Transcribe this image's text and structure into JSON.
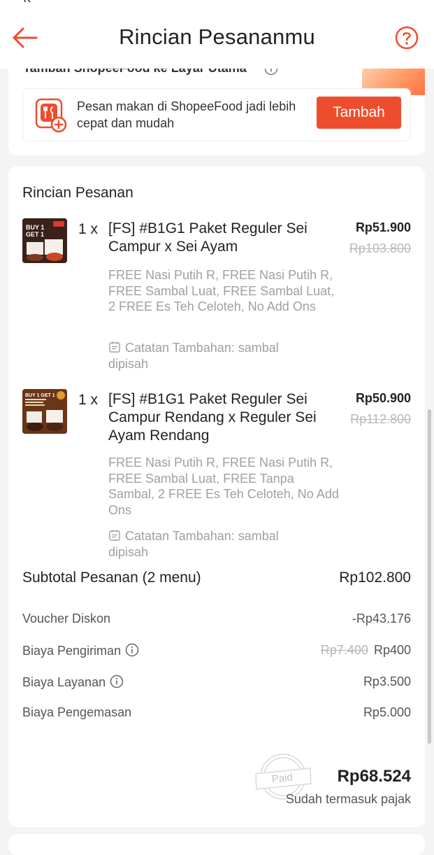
{
  "header": {
    "title": "Rincian Pesananmu",
    "status_fragment": "' K"
  },
  "promo": {
    "top_text": "Tambah ShopeeFood ke Layar Utama",
    "text": "Pesan makan di ShopeeFood jadi lebih cepat dan mudah",
    "button_label": "Tambah"
  },
  "order": {
    "section_title": "Rincian Pesanan",
    "items": [
      {
        "qty": "1 x",
        "name": "[FS] #B1G1 Paket Reguler Sei Campur x Sei Ayam",
        "price": "Rp51.900",
        "old_price": "Rp103.800",
        "addons": "FREE Nasi Putih R, FREE Nasi Putih R, FREE Sambal Luat, FREE Sambal Luat, 2 FREE Es Teh Celoteh, No Add Ons",
        "note": "Catatan Tambahan: sambal dipisah",
        "thumb_text": "BUY 1 GET 1"
      },
      {
        "qty": "1 x",
        "name": "[FS] #B1G1 Paket Reguler Sei Campur Rendang x Reguler Sei Ayam Rendang",
        "price": "Rp50.900",
        "old_price": "Rp112.800",
        "addons": "FREE Nasi Putih R, FREE Nasi Putih R, FREE Sambal Luat, FREE Tanpa Sambal, 2 FREE Es Teh Celoteh, No Add Ons",
        "note": "Catatan Tambahan: sambal dipisah",
        "thumb_text": "BUY 1 GET 1"
      }
    ],
    "subtotal_label": "Subtotal Pesanan (2 menu)",
    "subtotal_value": "Rp102.800",
    "fees": [
      {
        "label": "Voucher Diskon",
        "value": "-Rp43.176",
        "old_value": "",
        "info_icon": false
      },
      {
        "label": "Biaya Pengiriman",
        "value": "Rp400",
        "old_value": "Rp7.400",
        "info_icon": true
      },
      {
        "label": "Biaya Layanan",
        "value": "Rp3.500",
        "old_value": "",
        "info_icon": true
      },
      {
        "label": "Biaya Pengemasan",
        "value": "Rp5.000",
        "old_value": "",
        "info_icon": false
      }
    ],
    "paid_stamp": "Paid",
    "total_value": "Rp68.524",
    "total_note": "Sudah termasuk pajak"
  },
  "colors": {
    "accent": "#ee4d2d",
    "text_primary": "#222222",
    "text_muted": "#a0a0a0",
    "strikethrough": "#b8b8b8"
  },
  "icons": {
    "back": "arrow-left-icon",
    "help": "question-circle-icon",
    "info": "info-circle-icon",
    "note": "note-calendar-icon",
    "app": "shopeefood-app-icon"
  }
}
